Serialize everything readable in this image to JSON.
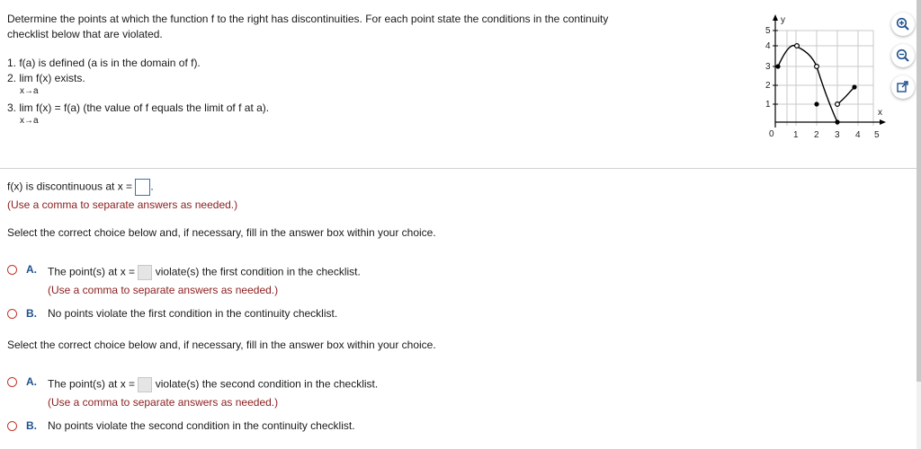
{
  "problem": {
    "line1": "Determine the points at which the function f to the right has discontinuities. For each point state the conditions in the continuity",
    "line2": "checklist below that are violated.",
    "cond1": "1. f(a) is defined (a is in the domain of f).",
    "cond2": "2.  lim  f(x) exists.",
    "cond2_sub": "x→a",
    "cond3": "3.  lim  f(x) = f(a) (the value of f equals the limit of f at a).",
    "cond3_sub": "x→a"
  },
  "graph": {
    "y_label": "y",
    "x_label": "x",
    "origin": "0",
    "x_ticks": [
      "1",
      "2",
      "3",
      "4",
      "5"
    ],
    "y_ticks": [
      "1",
      "2",
      "3",
      "4",
      "5"
    ]
  },
  "toolbar": {
    "zoom_in_icon": "zoom-in-icon",
    "zoom_out_icon": "zoom-out-icon",
    "popout_icon": "external-link-icon"
  },
  "part1": {
    "prompt": "f(x) is discontinuous at x =",
    "period": ".",
    "hint": "(Use a comma to separate answers as needed.)"
  },
  "part2": {
    "instruction": "Select the correct choice below and, if necessary, fill in the answer box within your choice.",
    "choiceA_letter": "A.",
    "choiceA_pre": "The point(s) at x =",
    "choiceA_post": "violate(s) the first condition in the checklist.",
    "choiceA_hint": "(Use a comma to separate answers as needed.)",
    "choiceB_letter": "B.",
    "choiceB_text": "No points violate the first condition in the continuity checklist."
  },
  "part3": {
    "instruction": "Select the correct choice below and, if necessary, fill in the answer box within your choice.",
    "choiceA_letter": "A.",
    "choiceA_pre": "The point(s) at x =",
    "choiceA_post": "violate(s) the second condition in the checklist.",
    "choiceA_hint": "(Use a comma to separate answers as needed.)",
    "choiceB_letter": "B.",
    "choiceB_text": "No points violate the second condition in the continuity checklist."
  },
  "colors": {
    "radio_border": "#c0392b",
    "choice_letter": "#1f4f8f",
    "hint_text": "#8b1d1d",
    "answer_box_border": "#3a6fb0"
  }
}
